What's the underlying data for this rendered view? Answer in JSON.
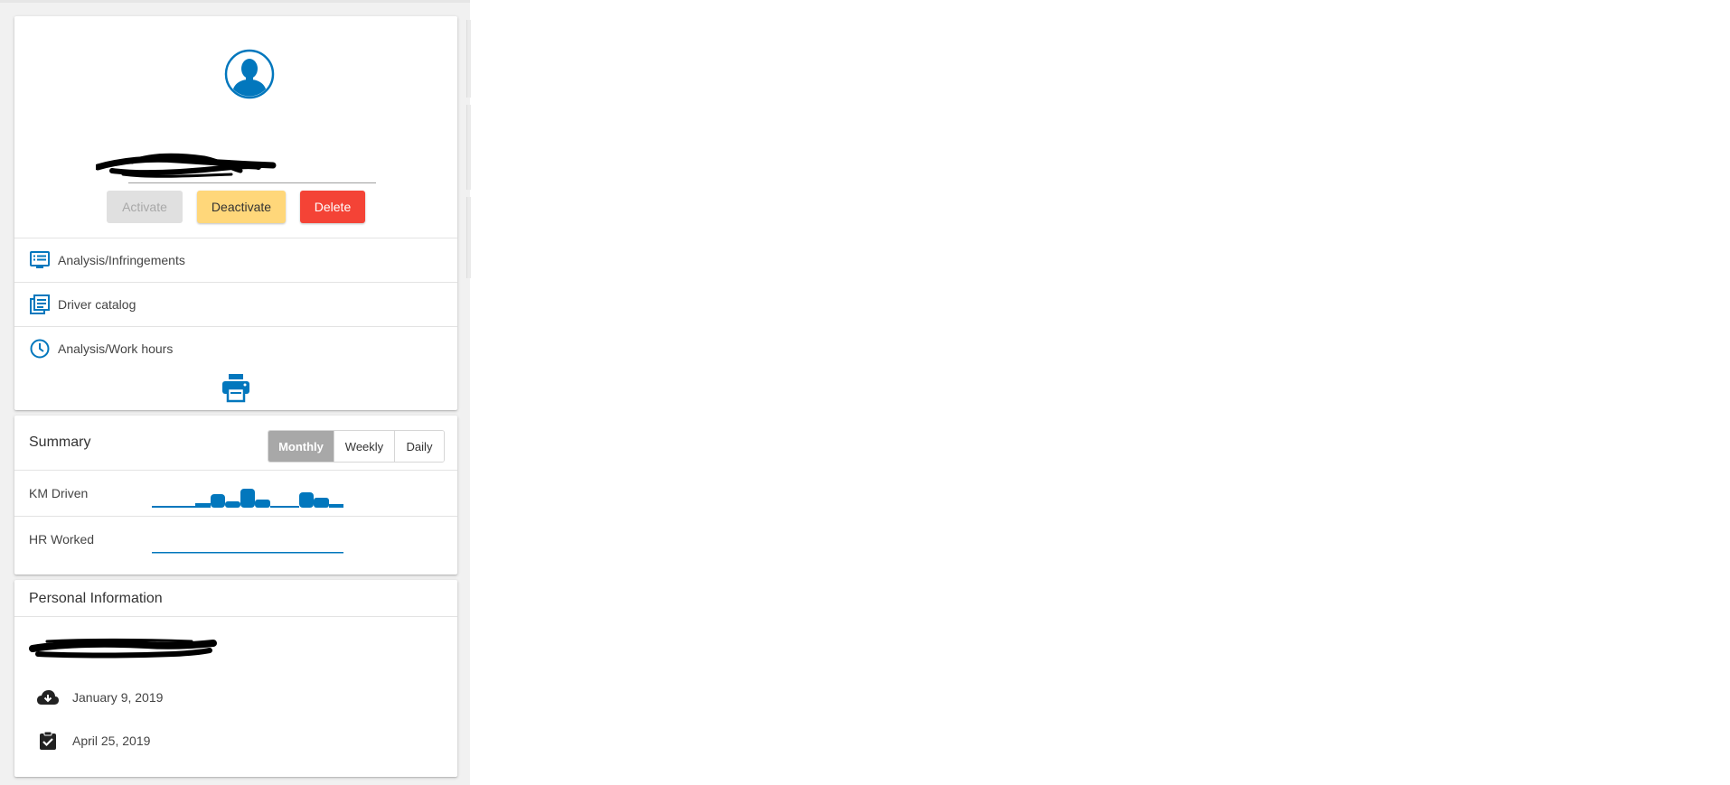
{
  "profile": {
    "name_redacted": true,
    "buttons": {
      "activate": "Activate",
      "deactivate": "Deactivate",
      "delete": "Delete"
    },
    "menu": [
      {
        "label": "Analysis/Infringements",
        "icon": "list-view-icon"
      },
      {
        "label": "Driver catalog",
        "icon": "catalog-icon"
      },
      {
        "label": "Analysis/Work hours",
        "icon": "clock-icon"
      }
    ],
    "print_icon": "printer-icon"
  },
  "summary": {
    "title": "Summary",
    "periods": [
      "Monthly",
      "Weekly",
      "Daily"
    ],
    "selected_period": "Monthly",
    "rows": [
      {
        "label": "KM Driven"
      },
      {
        "label": "HR Worked"
      }
    ]
  },
  "personal_info": {
    "title": "Personal Information",
    "dates": [
      {
        "icon": "cloud-download-icon",
        "value": "January 9, 2019"
      },
      {
        "icon": "assignment-turned-in-icon",
        "value": "April 25, 2019"
      }
    ]
  },
  "colors": {
    "accent": "#0277bd",
    "deactivate": "#ffd77a",
    "delete": "#f44336",
    "disabled": "#e0e0e0",
    "segment_active": "#a8a8a8"
  }
}
